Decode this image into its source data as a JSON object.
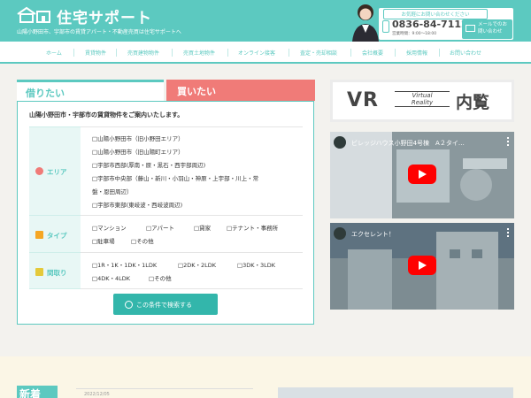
{
  "header": {
    "logo_text": "住宅サポート",
    "tagline": "山陽小野田市、宇部市の賃貸アパート・不動産売買は住宅サポートへ",
    "contact_label": "お気軽にお問い合わせください",
    "phone": "0836-84-7112",
    "hours": "営業時間：9:00～18:00",
    "mail_label": "メールでのお問い合わせ"
  },
  "nav": {
    "items": [
      "ホーム",
      "賃貸物件",
      "売買建物物件",
      "売買土地物件",
      "オンライン接客",
      "査定・売却相談",
      "会社概要",
      "採用情報",
      "お問い合わせ"
    ]
  },
  "search": {
    "tab_rent": "借りたい",
    "tab_buy": "買いたい",
    "intro": "山陽小野田市・宇部市の賃貸物件をご案内いたします。",
    "area_label": "エリア",
    "area_options": [
      "□山陽小野田市（旧小野田エリア）",
      "□山陽小野田市（旧山陽町エリア）",
      "□宇部市西部(厚南・原・黒石・西宇部周辺)",
      "□宇部市中央部（藤山・新川・小羽山・神原・上宇部・川上・常",
      "盤・恩田周辺）",
      "□宇部市東部(東岐波・西岐波周辺)"
    ],
    "type_label": "タイプ",
    "type_options": [
      "□マンション",
      "□アパート",
      "□貸家",
      "□テナント・事務所",
      "□駐車場",
      "□その他"
    ],
    "layout_label": "間取り",
    "layout_options": [
      "□1R・1K・1DK・1LDK",
      "□2DK・2LDK",
      "□3DK・3LDK",
      "□4DK・4LDK",
      "□その他"
    ],
    "search_button": "この条件で検索する"
  },
  "vr": {
    "main": "VR",
    "sub_1": "Virtual",
    "sub_2": "Reality",
    "jp": "内覧"
  },
  "videos": [
    {
      "title": "ビレッジハウス小野田4号棟　A２タイ…"
    },
    {
      "title": "エクセレント！"
    }
  ],
  "news": {
    "badge": "新着",
    "date": "2022/12/05"
  },
  "colors": {
    "primary": "#5cc9c0",
    "buy_tab": "#f07b78",
    "button": "#33b6ab"
  }
}
